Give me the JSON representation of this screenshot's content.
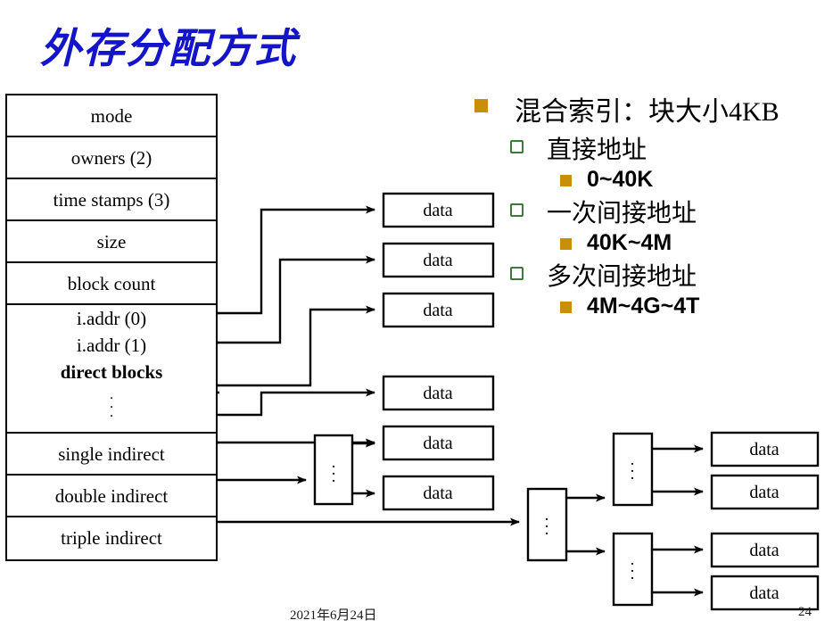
{
  "slide": {
    "title": "外存分配方式",
    "title_color": "#1414C8",
    "background": "#FFFFFF"
  },
  "inode_table": {
    "rows": [
      {
        "label": "mode"
      },
      {
        "label": "owners (2)"
      },
      {
        "label": "time stamps (3)"
      },
      {
        "label": "size"
      },
      {
        "label": "block count"
      }
    ],
    "direct_group": {
      "lines": [
        "i.addr (0)",
        "i.addr (1)",
        "direct blocks"
      ],
      "dots": "⋮"
    },
    "indirect_rows": [
      {
        "label": "single indirect"
      },
      {
        "label": "double indirect"
      },
      {
        "label": "triple indirect"
      }
    ]
  },
  "bullets": {
    "marker_level1_color": "#C8900A",
    "marker_level2_color": "#3B7A3B",
    "items": [
      {
        "level": 1,
        "text": "混合索引：块大小4KB"
      },
      {
        "level": 2,
        "text": "直接地址"
      },
      {
        "level": 3,
        "text": "0~40K"
      },
      {
        "level": 2,
        "text": "一次间接地址"
      },
      {
        "level": 3,
        "text": "40K~4M"
      },
      {
        "level": 2,
        "text": "多次间接地址"
      },
      {
        "level": 3,
        "text": "4M~4G~4T"
      }
    ]
  },
  "diagram": {
    "data_label": "data",
    "dots_label": "⋮",
    "direct_data_blocks": [
      "data",
      "data",
      "data",
      "data",
      "data",
      "data"
    ],
    "single_indirect_block": {
      "dots": "⋮"
    },
    "double_indirect_block": {
      "dots": "⋮"
    },
    "triple_level_blocks": [
      {
        "dots": "⋮"
      },
      {
        "dots": "⋮"
      }
    ],
    "right_data_blocks": [
      "data",
      "data",
      "data",
      "data"
    ]
  },
  "footer": {
    "date": "2021年6月24日",
    "page": "24"
  }
}
